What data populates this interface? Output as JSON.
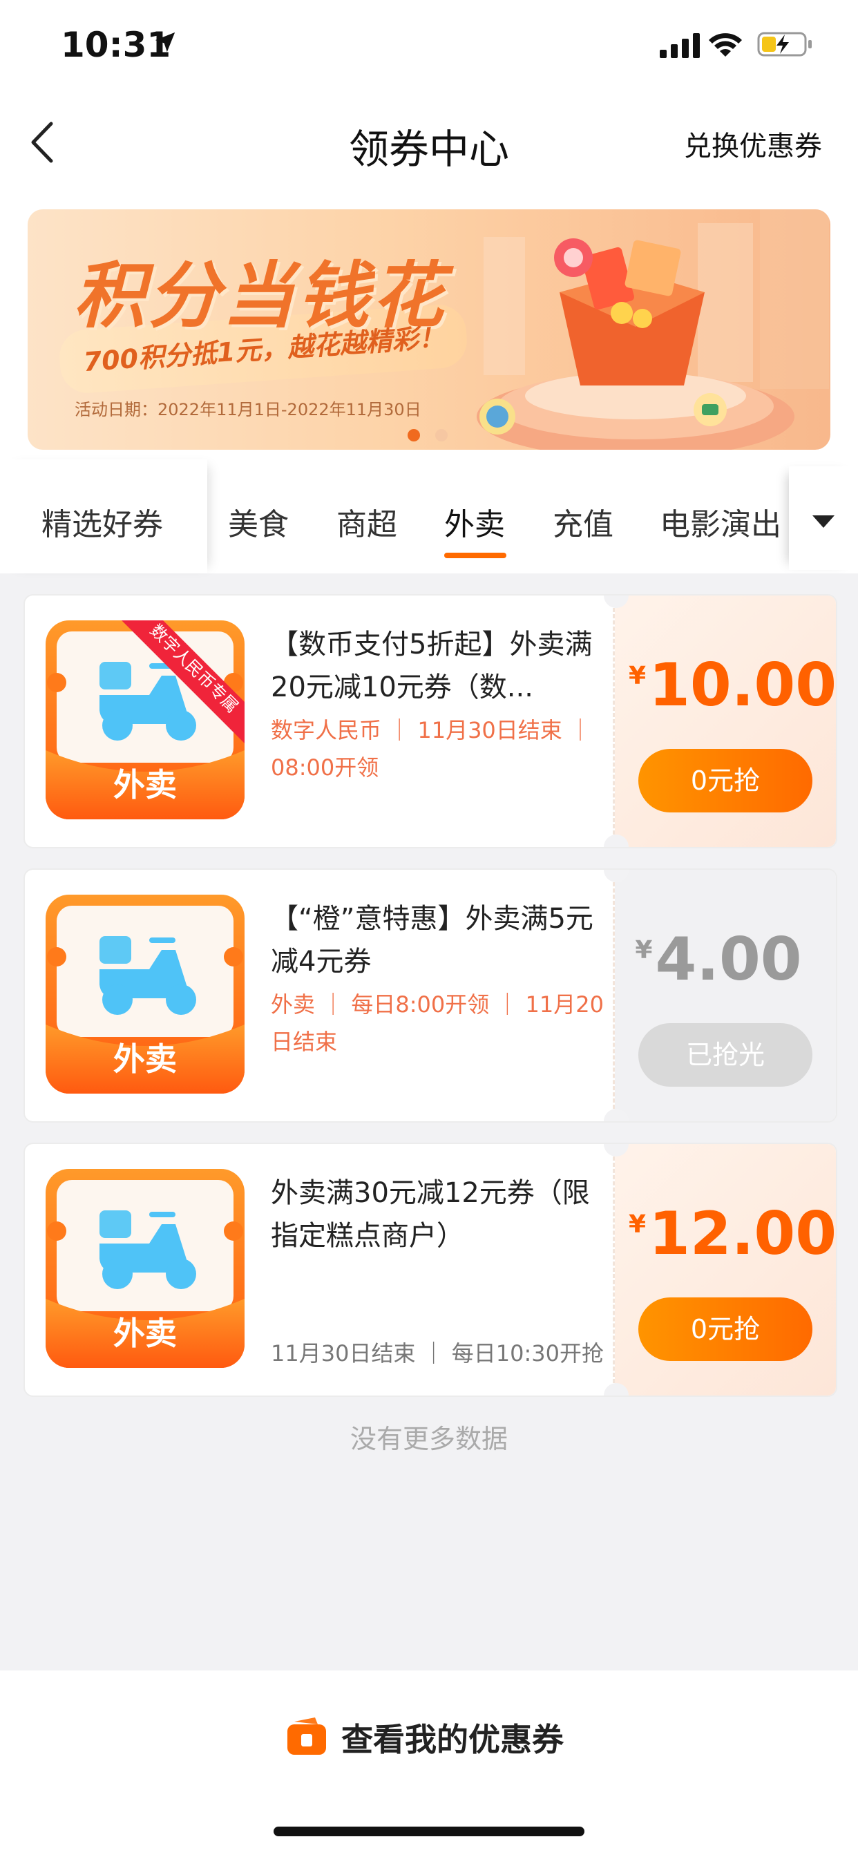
{
  "status_bar": {
    "time": "10:31",
    "location_icon": "location-arrow-icon",
    "signal_icon": "cellular-signal-icon",
    "wifi_icon": "wifi-icon",
    "battery_icon": "battery-charging-icon"
  },
  "header": {
    "back_icon": "chevron-left-icon",
    "title": "领券中心",
    "exchange_label": "兑换优惠券"
  },
  "banner": {
    "title": "积分当钱花",
    "subtitle": "700积分抵1元，越花越精彩！",
    "date_text": "活动日期：2022年11月1日-2022年11月30日",
    "slide_count": 2,
    "active_slide": 1
  },
  "tabs": {
    "items": [
      {
        "label": "精选好券",
        "active": false
      },
      {
        "label": "美食",
        "active": false
      },
      {
        "label": "商超",
        "active": false
      },
      {
        "label": "外卖",
        "active": true
      },
      {
        "label": "充值",
        "active": false
      },
      {
        "label": "电影演出",
        "active": false
      }
    ],
    "more_icon": "triangle-down-icon"
  },
  "coupons": [
    {
      "category_label": "外卖",
      "ribbon_label": "数字人民币专属",
      "title": "【数币支付5折起】外卖满20元减10元券（数...",
      "meta": "数字人民币 ｜ 11月30日结束 ｜ 08:00开领",
      "currency": "¥",
      "amount": "10.00",
      "button_label": "0元抢",
      "sold_out": false
    },
    {
      "category_label": "外卖",
      "title": "【“橙”意特惠】外卖满5元减4元券",
      "meta": "外卖 ｜ 每日8:00开领 ｜ 11月20日结束",
      "currency": "¥",
      "amount": "4.00",
      "button_label": "已抢光",
      "sold_out": true
    },
    {
      "category_label": "外卖",
      "title": "外卖满30元减12元券（限指定糕点商户）",
      "meta": "11月30日结束 ｜ 每日10:30开抢",
      "currency": "¥",
      "amount": "12.00",
      "button_label": "0元抢",
      "sold_out": false
    }
  ],
  "list_footer": "没有更多数据",
  "bottom_bar": {
    "icon": "coupon-wallet-icon",
    "label": "查看我的优惠券"
  },
  "colors": {
    "accent": "#ff6a00",
    "accent_light": "#ff9400",
    "meta_text": "#f07048",
    "disabled": "#d9d9d9"
  }
}
